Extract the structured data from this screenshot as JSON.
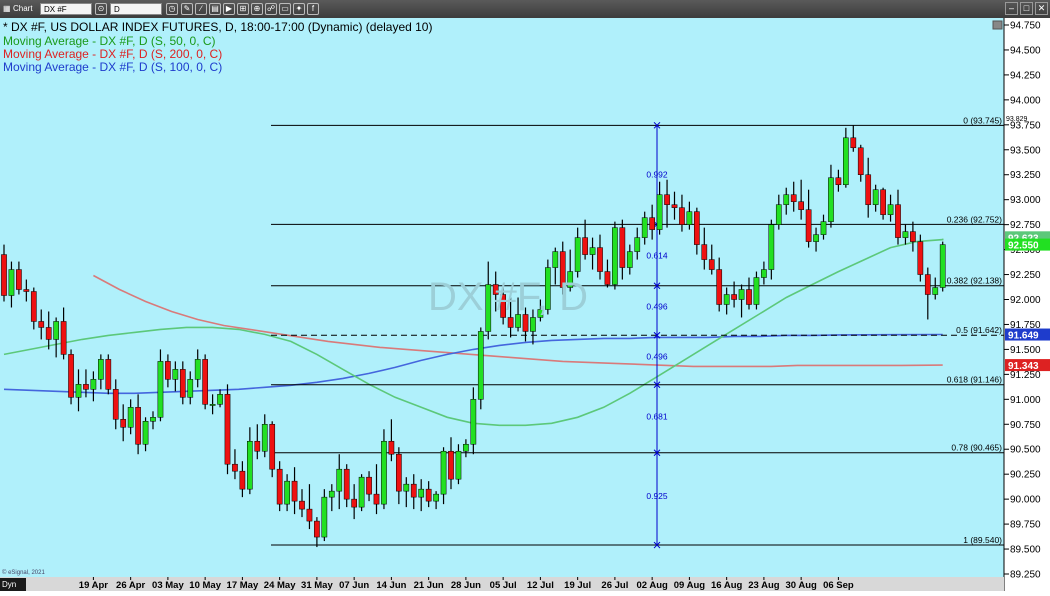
{
  "toolbar": {
    "app_label": "Chart",
    "symbol_value": "DX #F",
    "interval_value": "D"
  },
  "header": {
    "title": "* DX #F, US DOLLAR INDEX FUTURES, D, 18:00-17:00 (Dynamic) (delayed 10)",
    "ma50": "Moving Average - DX #F, D (S, 50, 0, C)",
    "ma200": "Moving Average - DX #F, D (S, 200, 0, C)",
    "ma100": "Moving Average - DX #F, D (S, 100, 0, C)"
  },
  "watermark": "DX #F, D",
  "copyright": "© eSignal, 2021",
  "cursor_mode": "Dyn",
  "colors": {
    "background": "#b0f0fb",
    "bull": "#22e022",
    "bear": "#ee1111",
    "ma50": "#5cc87a",
    "ma200": "#d97a7a",
    "ma100": "#4466dd",
    "fib": "#000000",
    "fib_labels": "#0000cc"
  },
  "chart_data": {
    "type": "candlestick",
    "y_axis": {
      "min": 89.25,
      "max": 94.75,
      "step": 0.25,
      "ticks": [
        "94.750",
        "94.500",
        "94.250",
        "94.000",
        "93.750",
        "93.500",
        "93.250",
        "93.000",
        "92.750",
        "92.500",
        "92.250",
        "92.000",
        "91.750",
        "91.500",
        "91.250",
        "91.000",
        "90.750",
        "90.500",
        "90.250",
        "90.000",
        "89.750",
        "89.500",
        "89.250"
      ]
    },
    "x_labels": [
      "19 Apr",
      "26 Apr",
      "03 May",
      "10 May",
      "17 May",
      "24 May",
      "31 May",
      "07 Jun",
      "14 Jun",
      "21 Jun",
      "28 Jun",
      "05 Jul",
      "12 Jul",
      "19 Jul",
      "26 Jul",
      "02 Aug",
      "09 Aug",
      "16 Aug",
      "23 Aug",
      "30 Aug",
      "06 Sep"
    ],
    "x_label_bar_index": [
      12,
      17,
      22,
      27,
      32,
      37,
      42,
      47,
      52,
      57,
      62,
      67,
      72,
      77,
      82,
      87,
      92,
      97,
      102,
      107,
      112
    ],
    "ohlc": [
      [
        92.45,
        92.55,
        91.98,
        92.04
      ],
      [
        92.04,
        92.38,
        91.92,
        92.3
      ],
      [
        92.3,
        92.38,
        92.05,
        92.1
      ],
      [
        92.1,
        92.2,
        91.98,
        92.08
      ],
      [
        92.08,
        92.12,
        91.7,
        91.78
      ],
      [
        91.78,
        91.9,
        91.6,
        91.72
      ],
      [
        91.72,
        91.88,
        91.5,
        91.6
      ],
      [
        91.6,
        91.82,
        91.42,
        91.78
      ],
      [
        91.78,
        91.92,
        91.4,
        91.45
      ],
      [
        91.45,
        91.5,
        90.95,
        91.02
      ],
      [
        91.02,
        91.3,
        90.88,
        91.15
      ],
      [
        91.15,
        91.3,
        91.02,
        91.1
      ],
      [
        91.1,
        91.28,
        90.98,
        91.2
      ],
      [
        91.2,
        91.45,
        91.1,
        91.4
      ],
      [
        91.4,
        91.45,
        91.05,
        91.1
      ],
      [
        91.1,
        91.2,
        90.7,
        90.8
      ],
      [
        90.8,
        90.95,
        90.58,
        90.72
      ],
      [
        90.72,
        91.0,
        90.65,
        90.92
      ],
      [
        90.92,
        91.05,
        90.45,
        90.55
      ],
      [
        90.55,
        90.82,
        90.48,
        90.78
      ],
      [
        90.78,
        90.88,
        90.7,
        90.82
      ],
      [
        90.82,
        91.5,
        90.78,
        91.38
      ],
      [
        91.38,
        91.45,
        91.12,
        91.2
      ],
      [
        91.2,
        91.38,
        91.08,
        91.3
      ],
      [
        91.3,
        91.38,
        90.95,
        91.02
      ],
      [
        91.02,
        91.28,
        90.95,
        91.2
      ],
      [
        91.2,
        91.5,
        91.12,
        91.4
      ],
      [
        91.4,
        91.45,
        90.9,
        90.95
      ],
      [
        90.95,
        91.05,
        90.85,
        90.95
      ],
      [
        90.95,
        91.1,
        90.92,
        91.05
      ],
      [
        91.05,
        91.15,
        90.25,
        90.35
      ],
      [
        90.35,
        90.5,
        90.2,
        90.28
      ],
      [
        90.28,
        90.38,
        90.02,
        90.1
      ],
      [
        90.1,
        90.72,
        90.05,
        90.58
      ],
      [
        90.58,
        90.75,
        90.4,
        90.48
      ],
      [
        90.48,
        90.85,
        90.42,
        90.75
      ],
      [
        90.75,
        90.78,
        90.22,
        90.3
      ],
      [
        90.3,
        90.38,
        89.88,
        89.95
      ],
      [
        89.95,
        90.25,
        89.88,
        90.18
      ],
      [
        90.18,
        90.32,
        89.85,
        89.98
      ],
      [
        89.98,
        90.1,
        89.82,
        89.9
      ],
      [
        89.9,
        90.15,
        89.7,
        89.78
      ],
      [
        89.78,
        89.82,
        89.52,
        89.62
      ],
      [
        89.62,
        90.1,
        89.58,
        90.02
      ],
      [
        90.02,
        90.15,
        89.88,
        90.08
      ],
      [
        90.08,
        90.45,
        89.9,
        90.3
      ],
      [
        90.3,
        90.35,
        89.92,
        90.0
      ],
      [
        90.0,
        90.15,
        89.8,
        89.92
      ],
      [
        89.92,
        90.25,
        89.88,
        90.22
      ],
      [
        90.22,
        90.28,
        89.98,
        90.05
      ],
      [
        90.05,
        90.35,
        89.85,
        89.95
      ],
      [
        89.95,
        90.7,
        89.9,
        90.58
      ],
      [
        90.58,
        90.8,
        90.38,
        90.45
      ],
      [
        90.45,
        90.52,
        89.95,
        90.08
      ],
      [
        90.08,
        90.22,
        89.92,
        90.15
      ],
      [
        90.15,
        90.25,
        89.9,
        90.02
      ],
      [
        90.02,
        90.2,
        89.88,
        90.1
      ],
      [
        90.1,
        90.18,
        89.92,
        89.98
      ],
      [
        89.98,
        90.08,
        89.9,
        90.05
      ],
      [
        90.05,
        90.52,
        89.95,
        90.48
      ],
      [
        90.48,
        90.62,
        90.1,
        90.2
      ],
      [
        90.2,
        90.55,
        90.15,
        90.48
      ],
      [
        90.48,
        90.6,
        90.42,
        90.55
      ],
      [
        90.55,
        91.12,
        90.45,
        91.0
      ],
      [
        91.0,
        91.72,
        90.9,
        91.68
      ],
      [
        91.68,
        92.38,
        91.6,
        92.15
      ],
      [
        92.15,
        92.28,
        91.88,
        92.05
      ],
      [
        92.05,
        92.15,
        91.75,
        91.82
      ],
      [
        91.82,
        92.02,
        91.62,
        91.72
      ],
      [
        91.72,
        92.02,
        91.68,
        91.85
      ],
      [
        91.85,
        91.92,
        91.58,
        91.68
      ],
      [
        91.68,
        91.9,
        91.55,
        91.82
      ],
      [
        91.82,
        92.0,
        91.78,
        91.9
      ],
      [
        91.9,
        92.4,
        91.85,
        92.32
      ],
      [
        92.32,
        92.52,
        92.15,
        92.48
      ],
      [
        92.48,
        92.58,
        92.05,
        92.12
      ],
      [
        92.12,
        92.5,
        92.08,
        92.28
      ],
      [
        92.28,
        92.72,
        92.22,
        92.62
      ],
      [
        92.62,
        92.8,
        92.4,
        92.45
      ],
      [
        92.45,
        92.62,
        92.3,
        92.52
      ],
      [
        92.52,
        92.65,
        92.2,
        92.28
      ],
      [
        92.28,
        92.4,
        92.12,
        92.15
      ],
      [
        92.15,
        92.78,
        92.1,
        92.72
      ],
      [
        92.72,
        92.8,
        92.2,
        92.32
      ],
      [
        92.32,
        92.55,
        92.25,
        92.48
      ],
      [
        92.48,
        92.72,
        92.4,
        92.62
      ],
      [
        92.62,
        92.88,
        92.55,
        92.82
      ],
      [
        92.82,
        92.95,
        92.6,
        92.7
      ],
      [
        92.7,
        93.18,
        92.65,
        93.05
      ],
      [
        93.05,
        93.2,
        92.72,
        92.95
      ],
      [
        92.95,
        93.08,
        92.8,
        92.92
      ],
      [
        92.92,
        93.05,
        92.68,
        92.75
      ],
      [
        92.75,
        92.98,
        92.7,
        92.88
      ],
      [
        92.88,
        92.92,
        92.45,
        92.55
      ],
      [
        92.55,
        92.72,
        92.3,
        92.4
      ],
      [
        92.4,
        92.55,
        92.25,
        92.3
      ],
      [
        92.3,
        92.42,
        91.88,
        91.95
      ],
      [
        91.95,
        92.12,
        91.85,
        92.05
      ],
      [
        92.05,
        92.18,
        91.92,
        92.0
      ],
      [
        92.0,
        92.15,
        91.82,
        92.1
      ],
      [
        92.1,
        92.22,
        91.9,
        91.95
      ],
      [
        91.95,
        92.28,
        91.9,
        92.22
      ],
      [
        92.22,
        92.38,
        92.15,
        92.3
      ],
      [
        92.3,
        92.8,
        92.2,
        92.75
      ],
      [
        92.75,
        93.05,
        92.7,
        92.95
      ],
      [
        92.95,
        93.12,
        92.85,
        93.05
      ],
      [
        93.05,
        93.18,
        92.88,
        92.98
      ],
      [
        92.98,
        93.2,
        92.8,
        92.9
      ],
      [
        92.9,
        93.1,
        92.52,
        92.58
      ],
      [
        92.58,
        92.72,
        92.48,
        92.65
      ],
      [
        92.65,
        92.85,
        92.6,
        92.78
      ],
      [
        92.78,
        93.35,
        92.72,
        93.22
      ],
      [
        93.22,
        93.3,
        93.08,
        93.15
      ],
      [
        93.15,
        93.72,
        93.12,
        93.62
      ],
      [
        93.62,
        93.745,
        93.48,
        93.52
      ],
      [
        93.52,
        93.55,
        93.18,
        93.25
      ],
      [
        93.25,
        93.42,
        92.82,
        92.95
      ],
      [
        92.95,
        93.15,
        92.88,
        93.1
      ],
      [
        93.1,
        93.12,
        92.8,
        92.85
      ],
      [
        92.85,
        93.05,
        92.78,
        92.95
      ],
      [
        92.95,
        93.1,
        92.55,
        92.62
      ],
      [
        92.62,
        92.75,
        92.55,
        92.68
      ],
      [
        92.68,
        92.78,
        92.48,
        92.58
      ],
      [
        92.58,
        92.65,
        92.18,
        92.25
      ],
      [
        92.25,
        92.32,
        91.8,
        92.05
      ],
      [
        92.05,
        92.22,
        92.0,
        92.12
      ],
      [
        92.12,
        92.58,
        92.08,
        92.55
      ]
    ],
    "ma50": [
      91.45,
      91.5,
      91.55,
      91.6,
      91.64,
      91.67,
      91.7,
      91.72,
      91.72,
      91.7,
      91.65,
      91.58,
      91.45,
      91.3,
      91.15,
      91.02,
      90.92,
      90.82,
      90.76,
      90.74,
      90.74,
      90.76,
      90.82,
      90.92,
      91.06,
      91.22,
      91.38,
      91.54,
      91.7,
      91.86,
      92.02,
      92.15,
      92.28,
      92.4,
      92.52,
      92.58,
      92.6,
      92.61
    ],
    "ma50_start_bar": 0,
    "ma50_bar_step": 3.5,
    "ma200": [
      92.24,
      92.1,
      91.98,
      91.88,
      91.8,
      91.74,
      91.7,
      91.66,
      91.62,
      91.58,
      91.55,
      91.52,
      91.5,
      91.48,
      91.46,
      91.44,
      91.42,
      91.4,
      91.38,
      91.37,
      91.36,
      91.35,
      91.34,
      91.33,
      91.33,
      91.33,
      91.33,
      91.34,
      91.34,
      91.34,
      91.34,
      91.34,
      91.343
    ],
    "ma200_start_bar": 12,
    "ma200_bar_step": 3.5,
    "ma100": [
      91.1,
      91.09,
      91.08,
      91.07,
      91.06,
      91.06,
      91.07,
      91.08,
      91.09,
      91.1,
      91.12,
      91.14,
      91.17,
      91.21,
      91.26,
      91.32,
      91.39,
      91.45,
      91.5,
      91.54,
      91.57,
      91.59,
      91.6,
      91.61,
      91.61,
      91.62,
      91.62,
      91.62,
      91.63,
      91.63,
      91.64,
      91.64,
      91.645,
      91.649
    ],
    "ma100_start_bar": 0,
    "ma100_bar_step": 3.5,
    "fibonacci": {
      "levels": [
        {
          "label": "0 (93.745)",
          "value": 93.745
        },
        {
          "label": "0.236 (92.752)",
          "value": 92.752
        },
        {
          "label": "0.382 (92.138)",
          "value": 92.138
        },
        {
          "label": "0.5 (91.642)",
          "value": 91.642
        },
        {
          "label": "0.618 (91.146)",
          "value": 91.146
        },
        {
          "label": "0.78 (90.465)",
          "value": 90.465
        },
        {
          "label": "1 (89.540)",
          "value": 89.54
        }
      ],
      "vertical_labels": [
        {
          "label": "0.992",
          "value": 93.25
        },
        {
          "label": "0.614",
          "value": 92.44
        },
        {
          "label": "0.496",
          "value": 91.93
        },
        {
          "label": "0.496",
          "value": 91.43
        },
        {
          "label": "0.681",
          "value": 90.83
        },
        {
          "label": "0.925",
          "value": 90.03
        }
      ]
    },
    "price_tags": [
      {
        "label": "92.623",
        "value": 92.623,
        "color": "#5cc87a"
      },
      {
        "label": "92.550",
        "value": 92.55,
        "color": "#22e022"
      },
      {
        "label": "91.649",
        "value": 91.649,
        "color": "#1e3ccc"
      },
      {
        "label": "91.343",
        "value": 91.343,
        "color": "#dd2222"
      }
    ],
    "high_marker": {
      "label": "93.829",
      "value": 93.82
    }
  }
}
